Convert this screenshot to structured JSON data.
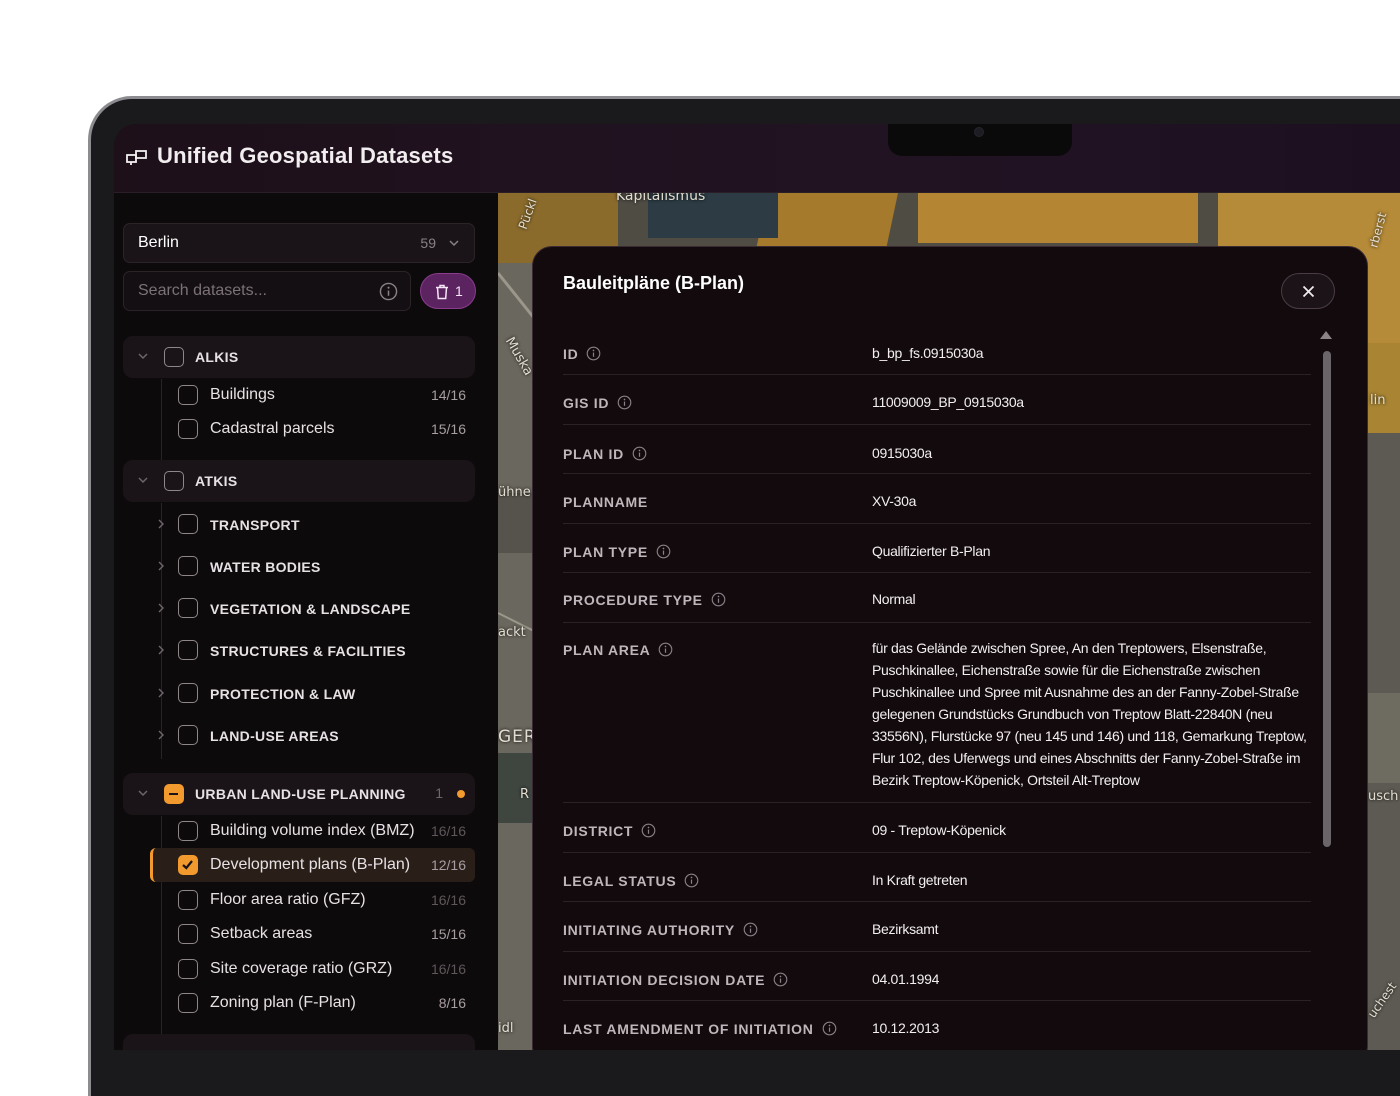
{
  "app": {
    "title": "Unified Geospatial Datasets"
  },
  "sidebar": {
    "city": {
      "label": "Berlin",
      "count": "59"
    },
    "search": {
      "placeholder": "Search datasets..."
    },
    "selection": {
      "count": "1"
    },
    "groups": [
      {
        "title": "ALKIS",
        "items": [
          {
            "name": "Buildings",
            "count": "14/16"
          },
          {
            "name": "Cadastral parcels",
            "count": "15/16"
          }
        ]
      },
      {
        "title": "ATKIS",
        "items": [
          {
            "name": "TRANSPORT"
          },
          {
            "name": "WATER BODIES"
          },
          {
            "name": "VEGETATION & LANDSCAPE"
          },
          {
            "name": "STRUCTURES & FACILITIES"
          },
          {
            "name": "PROTECTION & LAW"
          },
          {
            "name": "LAND-USE AREAS"
          }
        ]
      },
      {
        "title": "URBAN LAND-USE PLANNING",
        "count": "1",
        "items": [
          {
            "name": "Building volume index (BMZ)",
            "count": "16/16"
          },
          {
            "name": "Development plans (B-Plan)",
            "count": "12/16"
          },
          {
            "name": "Floor area ratio (GFZ)",
            "count": "16/16"
          },
          {
            "name": "Setback areas",
            "count": "15/16"
          },
          {
            "name": "Site coverage ratio (GRZ)",
            "count": "16/16"
          },
          {
            "name": "Zoning plan (F-Plan)",
            "count": "8/16"
          }
        ]
      }
    ]
  },
  "map": {
    "labels": [
      "Kapitalismus",
      "Pückl",
      "Muska",
      "ühne",
      "ackt",
      "GER",
      "R",
      "idl",
      "rberst",
      "lin",
      "usch",
      "uchest"
    ]
  },
  "detail": {
    "title": "Bauleitpläne (B-Plan)",
    "rows": [
      {
        "key": "ID",
        "value": "b_bp_fs.0915030a"
      },
      {
        "key": "GIS ID",
        "value": "11009009_BP_0915030a"
      },
      {
        "key": "PLAN ID",
        "value": "0915030a"
      },
      {
        "key": "PLANNAME",
        "value": "XV-30a"
      },
      {
        "key": "PLAN TYPE",
        "value": "Qualifizierter B-Plan"
      },
      {
        "key": "PROCEDURE TYPE",
        "value": "Normal"
      },
      {
        "key": "PLAN AREA",
        "value": "für das Gelände zwischen Spree, An den Treptowers, Elsenstraße, Puschkinallee, Eichenstraße sowie für die Eichenstraße zwischen Puschkinallee und Spree mit Ausnahme des an der Fanny-Zobel-Straße gelegenen Grundstücks Grundbuch von Treptow Blatt-22840N (neu 33556N), Flurstücke 97 (neu 145 und 146) und 118, Gemarkung Treptow, Flur 102, des Uferwegs und eines Abschnitts der Fanny-Zobel-Straße im Bezirk Treptow-Köpenick, Ortsteil Alt-Treptow"
      },
      {
        "key": "DISTRICT",
        "value": "09 - Treptow-Köpenick"
      },
      {
        "key": "LEGAL STATUS",
        "value": "In Kraft getreten"
      },
      {
        "key": "INITIATING AUTHORITY",
        "value": "Bezirksamt"
      },
      {
        "key": "INITIATION DECISION DATE",
        "value": "04.01.1994"
      },
      {
        "key": "LAST AMENDMENT OF INITIATION",
        "value": "10.12.2013"
      }
    ]
  }
}
